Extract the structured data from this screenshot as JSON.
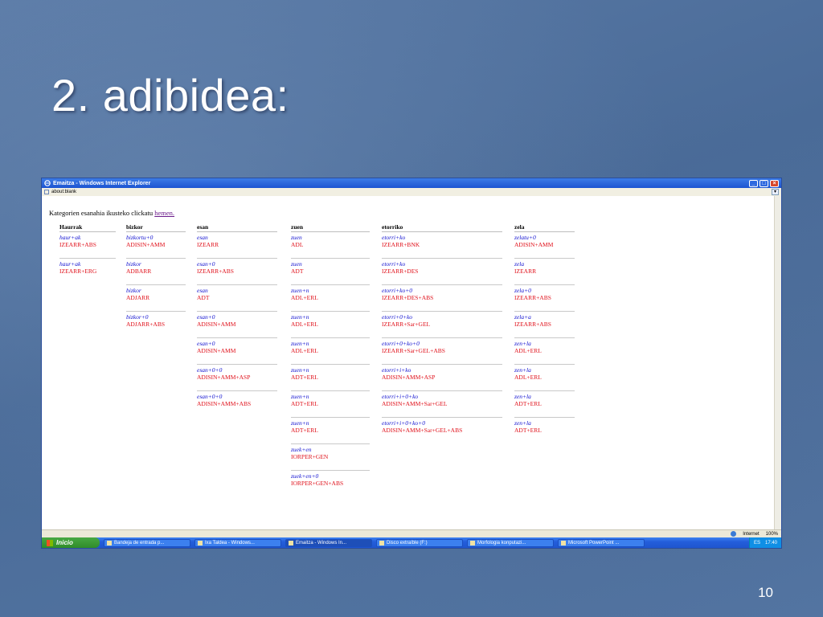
{
  "slide": {
    "title": "2. adibidea:",
    "number": "10"
  },
  "browser": {
    "title": "Emaitza - Windows Internet Explorer",
    "address": "about:blank",
    "buttons": {
      "minimize": "_",
      "maximize": "□",
      "close": "×"
    },
    "intro_text": "Kategorien esanahia ikusteko clickatu ",
    "intro_link": "hemen.",
    "columns": [
      {
        "header": "Haurrak",
        "entries": [
          {
            "form": "haur+ak",
            "cat": "IZEARR+ABS"
          },
          {
            "form": "haur+ak",
            "cat": "IZEARR+ERG"
          }
        ]
      },
      {
        "header": "bizkor",
        "entries": [
          {
            "form": "bizkortu+0",
            "cat": "ADISIN+AMM"
          },
          {
            "form": "bizkor",
            "cat": "ADBARR"
          },
          {
            "form": "bizkor",
            "cat": "ADJARR"
          },
          {
            "form": "bizkor+0",
            "cat": "ADJARR+ABS"
          }
        ]
      },
      {
        "header": "esan",
        "entries": [
          {
            "form": "esan",
            "cat": "IZEARR"
          },
          {
            "form": "esan+0",
            "cat": "IZEARR+ABS"
          },
          {
            "form": "esan",
            "cat": "ADT"
          },
          {
            "form": "esan+0",
            "cat": "ADISIN+AMM"
          },
          {
            "form": "esan+0",
            "cat": "ADISIN+AMM"
          },
          {
            "form": "esan+0+0",
            "cat": "ADISIN+AMM+ASP"
          },
          {
            "form": "esan+0+0",
            "cat": "ADISIN+AMM+ABS"
          }
        ]
      },
      {
        "header": "zuen",
        "entries": [
          {
            "form": "zuen",
            "cat": "ADL"
          },
          {
            "form": "zuen",
            "cat": "ADT"
          },
          {
            "form": "zuen+n",
            "cat": "ADL+ERL"
          },
          {
            "form": "zuen+n",
            "cat": "ADL+ERL"
          },
          {
            "form": "zuen+n",
            "cat": "ADL+ERL"
          },
          {
            "form": "zuen+n",
            "cat": "ADT+ERL"
          },
          {
            "form": "zuen+n",
            "cat": "ADT+ERL"
          },
          {
            "form": "zuen+n",
            "cat": "ADT+ERL"
          },
          {
            "form": "zuek+en",
            "cat": "IORPER+GEN"
          },
          {
            "form": "zuek+en+0",
            "cat": "IORPER+GEN+ABS"
          }
        ]
      },
      {
        "header": "etorriko",
        "entries": [
          {
            "form": "etorri+ko",
            "cat": "IZEARR+BNK"
          },
          {
            "form": "etorri+ko",
            "cat": "IZEARR+DES"
          },
          {
            "form": "etorri+ko+0",
            "cat": "IZEARR+DES+ABS"
          },
          {
            "form": "etorri+0+ko",
            "cat": "IZEARR+Sar+GEL"
          },
          {
            "form": "etorri+0+ko+0",
            "cat": "IZEARR+Sar+GEL+ABS"
          },
          {
            "form": "etorri+i+ko",
            "cat": "ADISIN+AMM+ASP"
          },
          {
            "form": "etorri+i+0+ko",
            "cat": "ADISIN+AMM+Sar+GEL"
          },
          {
            "form": "etorri+i+0+ko+0",
            "cat": "ADISIN+AMM+Sar+GEL+ABS"
          }
        ]
      },
      {
        "header": "zela",
        "entries": [
          {
            "form": "zelatu+0",
            "cat": "ADISIN+AMM"
          },
          {
            "form": "zela",
            "cat": "IZEARR"
          },
          {
            "form": "zela+0",
            "cat": "IZEARR+ABS"
          },
          {
            "form": "zela+a",
            "cat": "IZEARR+ABS"
          },
          {
            "form": "zen+la",
            "cat": "ADL+ERL"
          },
          {
            "form": "zen+la",
            "cat": "ADL+ERL"
          },
          {
            "form": "zen+la",
            "cat": "ADT+ERL"
          },
          {
            "form": "zen+la",
            "cat": "ADT+ERL"
          }
        ]
      }
    ],
    "status": {
      "zone": "Internet",
      "zoom": "100%"
    },
    "taskbar": {
      "start": "Inicio",
      "tasks": [
        "Bandeja de entrada p...",
        "Ixa Taldea - Windows...",
        "Emaitza - Windows In...",
        "Disco extraíble (F:)",
        "Morfologia konputazi...",
        "Microsoft PowerPoint ..."
      ],
      "active_task": 2,
      "lang": "ES",
      "clock": "17:40"
    }
  },
  "colors": {
    "form": "#1010d0",
    "category": "#e0101a",
    "link": "#6a1a8a"
  }
}
